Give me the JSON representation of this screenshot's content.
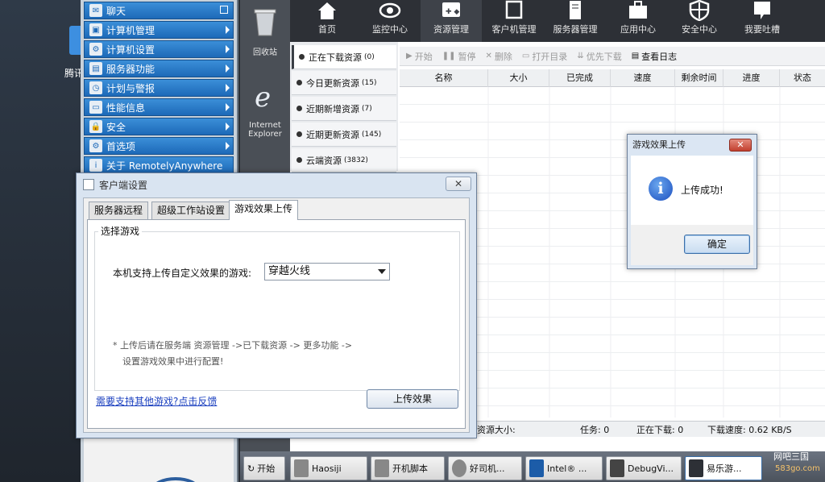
{
  "desktop": {
    "icon_label": "腾讯"
  },
  "left_menu": {
    "items": [
      {
        "label": "聊天",
        "icon": "chat-icon"
      },
      {
        "label": "计算机管理",
        "icon": "computer-icon"
      },
      {
        "label": "计算机设置",
        "icon": "settings-icon"
      },
      {
        "label": "服务器功能",
        "icon": "server-icon"
      },
      {
        "label": "计划与警报",
        "icon": "clock-icon"
      },
      {
        "label": "性能信息",
        "icon": "monitor-icon"
      },
      {
        "label": "安全",
        "icon": "lock-icon"
      },
      {
        "label": "首选项",
        "icon": "gear-icon"
      },
      {
        "label": "关于 RemotelyAnywhere",
        "icon": "info-icon"
      }
    ]
  },
  "icon_strip": {
    "items": [
      {
        "label": "回收站",
        "icon": "recycle-bin-icon"
      },
      {
        "label": "Internet Explorer",
        "icon": "ie-icon"
      }
    ]
  },
  "top_nav": {
    "items": [
      {
        "label": "首页",
        "icon": "home-icon"
      },
      {
        "label": "监控中心",
        "icon": "eye-icon"
      },
      {
        "label": "资源管理",
        "icon": "gamepad-icon"
      },
      {
        "label": "客户机管理",
        "icon": "computer-icon"
      },
      {
        "label": "服务器管理",
        "icon": "server-icon"
      },
      {
        "label": "应用中心",
        "icon": "toolbox-icon"
      },
      {
        "label": "安全中心",
        "icon": "shield-icon"
      },
      {
        "label": "我要吐槽",
        "icon": "chat-bubble-icon"
      }
    ],
    "active_index": 2
  },
  "resource_sidebar": {
    "items": [
      {
        "label": "正在下载资源",
        "count": "(0)"
      },
      {
        "label": "今日更新资源",
        "count": "(15)"
      },
      {
        "label": "近期新增资源",
        "count": "(7)"
      },
      {
        "label": "近期更新资源",
        "count": "(145)"
      },
      {
        "label": "云端资源",
        "count": "(3832)"
      }
    ],
    "active_index": 0
  },
  "toolbar": {
    "buttons": [
      {
        "label": "开始",
        "icon": "play-icon",
        "enabled": false
      },
      {
        "label": "暂停",
        "icon": "pause-icon",
        "enabled": false
      },
      {
        "label": "删除",
        "icon": "delete-icon",
        "enabled": false
      },
      {
        "label": "打开目录",
        "icon": "folder-icon",
        "enabled": false
      },
      {
        "label": "优先下载",
        "icon": "priority-icon",
        "enabled": false
      },
      {
        "label": "查看日志",
        "icon": "log-icon",
        "enabled": true
      }
    ]
  },
  "table": {
    "columns": [
      "名称",
      "大小",
      "已完成",
      "速度",
      "剩余时间",
      "进度",
      "状态"
    ],
    "rows": []
  },
  "status_bar": {
    "resource_size": "资源大小:",
    "tasks": "任务: 0",
    "downloading": "正在下载: 0",
    "download_speed": "下载速度: 0.62 KB/S"
  },
  "taskbar": {
    "items": [
      {
        "label": "开始",
        "icon": "start-icon"
      },
      {
        "label": "Haosiji",
        "icon": "folder-icon"
      },
      {
        "label": "开机脚本",
        "icon": "folder-icon"
      },
      {
        "label": "好司机...",
        "icon": "app-icon"
      },
      {
        "label": "Intel® ...",
        "icon": "intel-icon"
      },
      {
        "label": "DebugVi...",
        "icon": "bug-icon"
      },
      {
        "label": "易乐游...",
        "icon": "app-icon"
      }
    ],
    "active_index": 6,
    "watermark": "网吧三国",
    "watermark_sub": "583go.com"
  },
  "client_dialog": {
    "title": "客户端设置",
    "close_label": "✕",
    "tabs": [
      "服务器远程",
      "超级工作站设置",
      "游戏效果上传"
    ],
    "active_tab": 2,
    "group_title": "选择游戏",
    "game_label": "本机支持上传自定义效果的游戏:",
    "selected_game": "穿越火线",
    "note_line1": "* 上传后请在服务端 资源管理 ->已下载资源 -> 更多功能 ->",
    "note_line2": "设置游戏效果中进行配置!",
    "feedback_link": "需要支持其他游戏?点击反馈",
    "upload_button": "上传效果"
  },
  "message_box": {
    "title": "游戏效果上传",
    "close_label": "✕",
    "message": "上传成功!",
    "ok_button": "确定"
  }
}
